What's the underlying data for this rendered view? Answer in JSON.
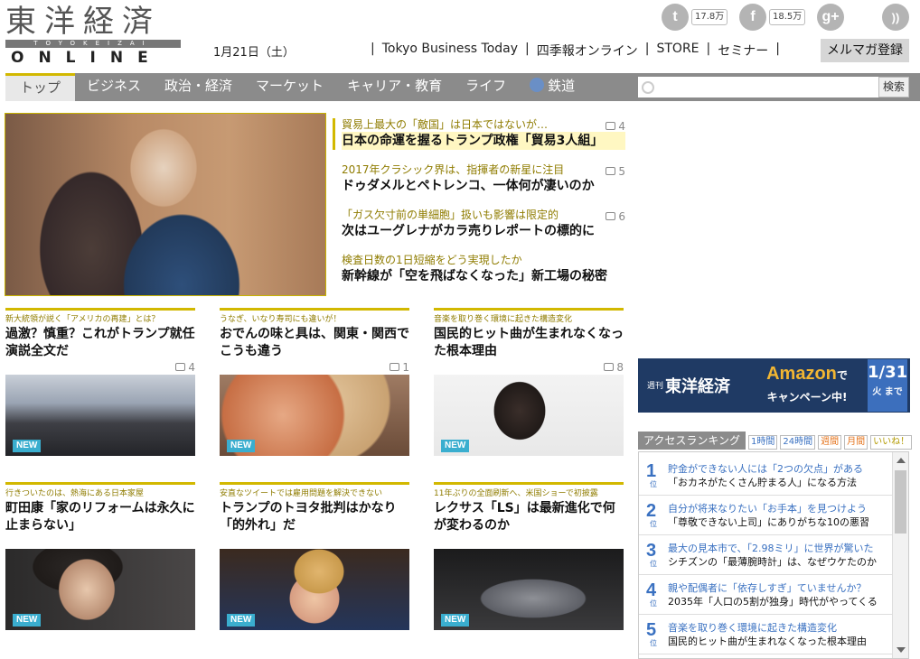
{
  "header": {
    "logo_kanji": "東洋経済",
    "logo_sub": "TOYOKEIZAI",
    "logo_online": "ONLINE",
    "date": "1月21日（土）",
    "links": [
      "Tokyo Business Today",
      "四季報オンライン",
      "STORE",
      "セミナー"
    ],
    "mailmag": "メルマガ登録",
    "social": [
      {
        "icon": "twitter-icon",
        "glyph": "t",
        "count": "17.8万"
      },
      {
        "icon": "facebook-icon",
        "glyph": "f",
        "count": "18.5万"
      },
      {
        "icon": "google-plus-icon",
        "glyph": "g+",
        "count": ""
      },
      {
        "icon": "rss-icon",
        "glyph": "))",
        "count": ""
      }
    ]
  },
  "nav": {
    "items": [
      "トップ",
      "ビジネス",
      "政治・経済",
      "マーケット",
      "キャリア・教育",
      "ライフ",
      "鉄道"
    ],
    "search_button": "検索",
    "search_placeholder": ""
  },
  "feature": {
    "items": [
      {
        "kicker": "貿易上最大の「敵国」は日本ではないが…",
        "title": "日本の命運を握るトランプ政権「貿易3人組」",
        "comments": "4"
      },
      {
        "kicker": "2017年クラシック界は、指揮者の新星に注目",
        "title": "ドゥダメルとペトレンコ、一体何が凄いのか",
        "comments": "5"
      },
      {
        "kicker": "「ガス欠寸前の単細胞」扱いも影響は限定的",
        "title": "次はユーグレナがカラ売りレポートの標的に",
        "comments": "6"
      },
      {
        "kicker": "検査日数の1日短縮をどう実現したか",
        "title": "新幹線が「空を飛ばなくなった」新工場の秘密",
        "comments": ""
      }
    ]
  },
  "articles": [
    {
      "kicker": "新大統領が説く「アメリカの再建」とは？",
      "title": "過激？慎重？これがトランプ就任演説全文だ",
      "comments": "4",
      "badge": "NEW"
    },
    {
      "kicker": "うなぎ、いなり寿司にも違いが！",
      "title": "おでんの味と具は、関東・関西でこうも違う",
      "comments": "1",
      "badge": "NEW"
    },
    {
      "kicker": "音楽を取り巻く環境に起きた構造変化",
      "title": "国民的ヒット曲が生まれなくなった根本理由",
      "comments": "8",
      "badge": "NEW"
    },
    {
      "kicker": "行きついたのは、熱海にある日本家屋",
      "title": "町田康「家のリフォームは永久に止まらない」",
      "comments": "",
      "badge": "NEW"
    },
    {
      "kicker": "安直なツイートでは雇用問題を解決できない",
      "title": "トランプのトヨタ批判はかなり「的外れ」だ",
      "comments": "",
      "badge": "NEW"
    },
    {
      "kicker": "11年ぶりの全面刷新へ、米国ショーで初披露",
      "title": "レクサス「LS」は最新進化で何が変わるのか",
      "comments": "",
      "badge": "NEW"
    }
  ],
  "banner": {
    "weekly_small": "週刊",
    "weekly": "東洋経済",
    "amazon": "Amazon",
    "amazon_suffix": "で",
    "campaign": "キャンペーン中!",
    "date": "1/31",
    "until": "火 まで"
  },
  "ranking": {
    "title": "アクセスランキング",
    "tabs": [
      "1時間",
      "24時間",
      "週間",
      "月間",
      "いいね！"
    ],
    "rank_suffix": "位",
    "items": [
      {
        "rank": "1",
        "kicker": "貯金ができない人には「2つの欠点」がある",
        "title": "「おカネがたくさん貯まる人」になる方法"
      },
      {
        "rank": "2",
        "kicker": "自分が将来なりたい「お手本」を見つけよう",
        "title": "「尊敬できない上司」にありがちな10の悪習"
      },
      {
        "rank": "3",
        "kicker": "最大の見本市で、「2.98ミリ」に世界が驚いた",
        "title": "シチズンの「最薄腕時計」は、なぜウケたのか"
      },
      {
        "rank": "4",
        "kicker": "親や配偶者に「依存しすぎ」ていませんか？",
        "title": "2035年「人口の5割が独身」時代がやってくる"
      },
      {
        "rank": "5",
        "kicker": "音楽を取り巻く環境に起きた構造変化",
        "title": "国民的ヒット曲が生まれなくなった根本理由"
      }
    ]
  }
}
